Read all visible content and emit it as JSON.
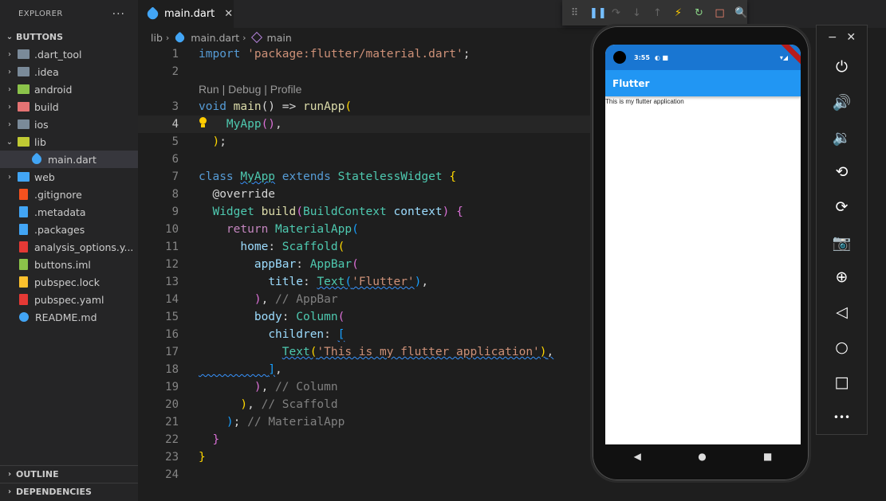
{
  "explorer": {
    "title": "EXPLORER",
    "more": "···",
    "root_label": "BUTTONS",
    "items": [
      {
        "label": ".dart_tool",
        "type": "folder",
        "color": "#7a8a99"
      },
      {
        "label": ".idea",
        "type": "folder",
        "color": "#7a8a99"
      },
      {
        "label": "android",
        "type": "folder",
        "color": "#8bc34a"
      },
      {
        "label": "build",
        "type": "folder",
        "color": "#e57373"
      },
      {
        "label": "ios",
        "type": "folder",
        "color": "#7a8a99"
      },
      {
        "label": "lib",
        "type": "folder-open",
        "color": "#c0ca33"
      },
      {
        "label": "main.dart",
        "type": "dart",
        "color": "#42a5f5"
      },
      {
        "label": "web",
        "type": "folder",
        "color": "#42a5f5"
      },
      {
        "label": ".gitignore",
        "type": "git",
        "color": "#f4511e"
      },
      {
        "label": ".metadata",
        "type": "file",
        "color": "#42a5f5"
      },
      {
        "label": ".packages",
        "type": "file",
        "color": "#42a5f5"
      },
      {
        "label": "analysis_options.y...",
        "type": "yaml",
        "color": "#e53935"
      },
      {
        "label": "buttons.iml",
        "type": "iml",
        "color": "#8bc34a"
      },
      {
        "label": "pubspec.lock",
        "type": "lock",
        "color": "#fbc02d"
      },
      {
        "label": "pubspec.yaml",
        "type": "yaml",
        "color": "#e53935"
      },
      {
        "label": "README.md",
        "type": "info",
        "color": "#42a5f5"
      }
    ],
    "outline_label": "OUTLINE",
    "dependencies_label": "DEPENDENCIES"
  },
  "tab": {
    "label": "main.dart",
    "close": "✕"
  },
  "breadcrumb": {
    "folder": "lib",
    "file": "main.dart",
    "symbol": "main"
  },
  "code_lens": "Run | Debug | Profile",
  "line_numbers": [
    "1",
    "2",
    "3",
    "4",
    "5",
    "6",
    "7",
    "8",
    "9",
    "10",
    "11",
    "12",
    "13",
    "14",
    "15",
    "16",
    "17",
    "18",
    "19",
    "20",
    "21",
    "22",
    "23",
    "24"
  ],
  "code": {
    "import_kw": "import",
    "import_str": "'package:flutter/material.dart'",
    "semi": ";",
    "void_kw": "void",
    "main_fn": "main",
    "arrow": "() =>",
    "runapp_fn": "runApp",
    "myapp_call": "MyApp",
    "class_kw": "class",
    "myapp_cls": "MyApp",
    "extends_kw": "extends",
    "stateless": "StatelessWidget",
    "override": "@override",
    "widget_cls": "Widget",
    "build_fn": "build",
    "buildcontext": "BuildContext",
    "context": "context",
    "return_kw": "return",
    "materialapp": "MaterialApp",
    "home": "home",
    "scaffold": "Scaffold",
    "appbar_prop": "appBar",
    "appbar_cls": "AppBar",
    "title_prop": "title",
    "text_cls": "Text",
    "flutter_str": "'Flutter'",
    "appbar_comment": "// AppBar",
    "body_prop": "body",
    "column_cls": "Column",
    "children_prop": "children",
    "app_str": "'This is my flutter application'",
    "column_comment": "// Column",
    "scaffold_comment": "// Scaffold",
    "materialapp_comment": "// MaterialApp"
  },
  "phone": {
    "time": "3:55",
    "status_icons": "◐ ■",
    "signal": "▾◢",
    "app_title": "Flutter",
    "body_text": "This is my flutter application",
    "nav_back": "◀",
    "nav_home": "●",
    "nav_recent": "■"
  },
  "emulator": {
    "minimize": "−",
    "close": "✕",
    "buttons": [
      {
        "name": "power-icon",
        "glyph": "⏻"
      },
      {
        "name": "volume-up-icon",
        "glyph": "🔊"
      },
      {
        "name": "volume-down-icon",
        "glyph": "🔉"
      },
      {
        "name": "rotate-left-icon",
        "glyph": "⟲"
      },
      {
        "name": "rotate-right-icon",
        "glyph": "⟳"
      },
      {
        "name": "camera-icon",
        "glyph": "📷"
      },
      {
        "name": "zoom-icon",
        "glyph": "⊕"
      },
      {
        "name": "back-icon",
        "glyph": "◁"
      },
      {
        "name": "home-icon",
        "glyph": "○"
      },
      {
        "name": "overview-icon",
        "glyph": "□"
      },
      {
        "name": "more-icon",
        "glyph": "•••"
      }
    ]
  },
  "debug_toolbar": [
    {
      "name": "drag-handle-icon",
      "glyph": "⠿",
      "color": "#888888"
    },
    {
      "name": "pause-icon",
      "glyph": "❚❚",
      "color": "#75beff"
    },
    {
      "name": "step-over-icon",
      "glyph": "↷",
      "color": "#666666"
    },
    {
      "name": "step-into-icon",
      "glyph": "↓",
      "color": "#666666"
    },
    {
      "name": "step-out-icon",
      "glyph": "↑",
      "color": "#666666"
    },
    {
      "name": "hot-reload-icon",
      "glyph": "⚡",
      "color": "#ffcc00"
    },
    {
      "name": "restart-icon",
      "glyph": "↻",
      "color": "#89d185"
    },
    {
      "name": "stop-icon",
      "glyph": "□",
      "color": "#f48771"
    },
    {
      "name": "inspect-icon",
      "glyph": "🔍",
      "color": "#3794ff"
    }
  ]
}
